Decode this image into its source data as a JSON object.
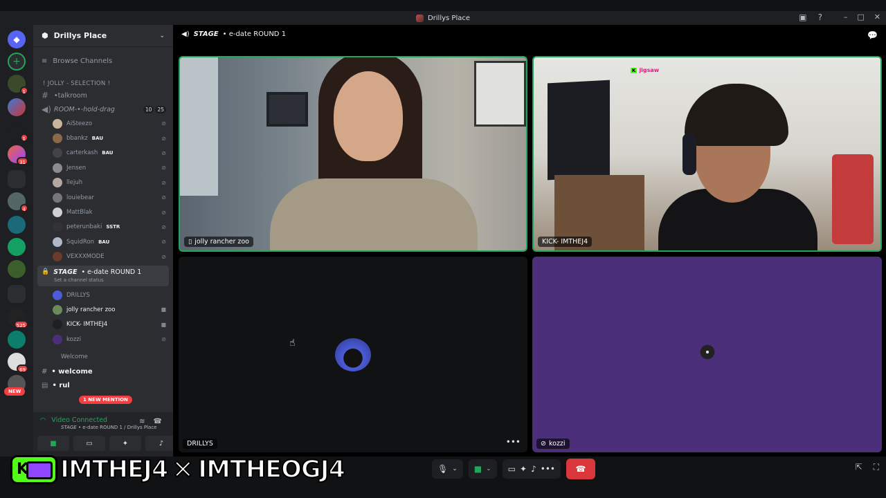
{
  "window": {
    "title": "Drillys Place"
  },
  "server": {
    "name": "Drillys Place"
  },
  "sidebar": {
    "browse_label": "Browse Channels",
    "category_jolly": "! JOLLY - SELECTION !",
    "talkroom": "•talkroom",
    "room_holddrag": "ROOM-•-hold-drag",
    "room_counts": [
      "10",
      "25"
    ],
    "room_users": [
      {
        "name": "AiSteezo",
        "tag": ""
      },
      {
        "name": "bbankz",
        "tag": "BAU"
      },
      {
        "name": "carterkash",
        "tag": "BAU"
      },
      {
        "name": "Jensen",
        "tag": ""
      },
      {
        "name": "llejuh",
        "tag": ""
      },
      {
        "name": "louiebear",
        "tag": ""
      },
      {
        "name": "MattBlak",
        "tag": ""
      },
      {
        "name": "peterunbaki",
        "tag": "SSTR"
      },
      {
        "name": "SquidRon",
        "tag": "BAU"
      },
      {
        "name": "VEXXXMODE",
        "tag": ""
      }
    ],
    "stage_prefix": "STAGE",
    "stage_title": "• e-date ROUND 1",
    "stage_status": "Set a channel status",
    "stage_users": [
      "DRILLYS",
      "jolly rancher zoo",
      "KICK- IMTHEJ4",
      "kozzi"
    ],
    "welcome_category": "Welcome",
    "welcome_channel": "• welcome",
    "rules_channel": "• rul",
    "mention_badge": "1 NEW MENTION",
    "new_badge": "NEW"
  },
  "servers": {
    "badges": [
      "1",
      "1",
      "1",
      "31",
      "4",
      "525",
      "69"
    ]
  },
  "voice": {
    "status": "Video Connected",
    "prefix": "STAGE",
    "subtitle": "• e-date ROUND 1 / Drillys Place"
  },
  "main": {
    "header_prefix": "STAGE",
    "header_title": "• e-date ROUND 1",
    "tiles": [
      {
        "name": "jolly rancher zoo"
      },
      {
        "name": "KICK- IMTHEJ4"
      },
      {
        "name": "DRILLYS"
      },
      {
        "name": "kozzi"
      }
    ],
    "kick_overlay": "jigsaw"
  },
  "banner": {
    "left": "IMTHEJ4",
    "right": "IMTHEOGJ4"
  },
  "colors": {
    "accent_green": "#23a55a",
    "danger_red": "#da373c",
    "purple_tile": "#4b2f7a",
    "mention_red": "#f23f43",
    "kick_green": "#53fc18",
    "twitch_purple": "#9146ff"
  }
}
